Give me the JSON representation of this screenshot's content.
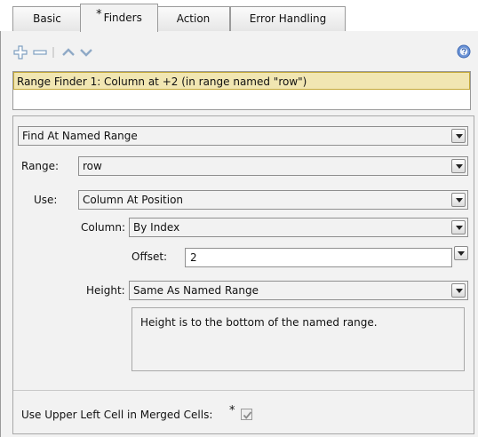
{
  "tabs": [
    {
      "label": "Basic",
      "active": false,
      "required": false
    },
    {
      "label": "Finders",
      "active": true,
      "required": true
    },
    {
      "label": "Action",
      "active": false,
      "required": false
    },
    {
      "label": "Error Handling",
      "active": false,
      "required": false
    }
  ],
  "required_marker": "*",
  "toolbar": {
    "icons": [
      "add-icon",
      "remove-icon",
      "move-up-icon",
      "move-down-icon",
      "help-icon"
    ]
  },
  "finders": [
    {
      "label": "Range Finder 1: Column at +2 (in range named \"row\")",
      "selected": true
    }
  ],
  "detail": {
    "finder_type": "Find At Named Range",
    "range_label": "Range:",
    "range_value": "row",
    "use_label": "Use:",
    "use_value": "Column At Position",
    "column_label": "Column:",
    "column_value": "By Index",
    "offset_label": "Offset:",
    "offset_value": "2",
    "height_label": "Height:",
    "height_value": "Same As Named Range",
    "height_description": "Height is to the bottom of the named range.",
    "merged_label": "Use Upper Left Cell in Merged Cells:",
    "merged_checked": true
  },
  "colors": {
    "selection_bg": "#f1e6b2",
    "selection_border": "#c4a93a",
    "panel_bg": "#f2f2f2",
    "toolbar_icon": "#7f9fc0"
  }
}
